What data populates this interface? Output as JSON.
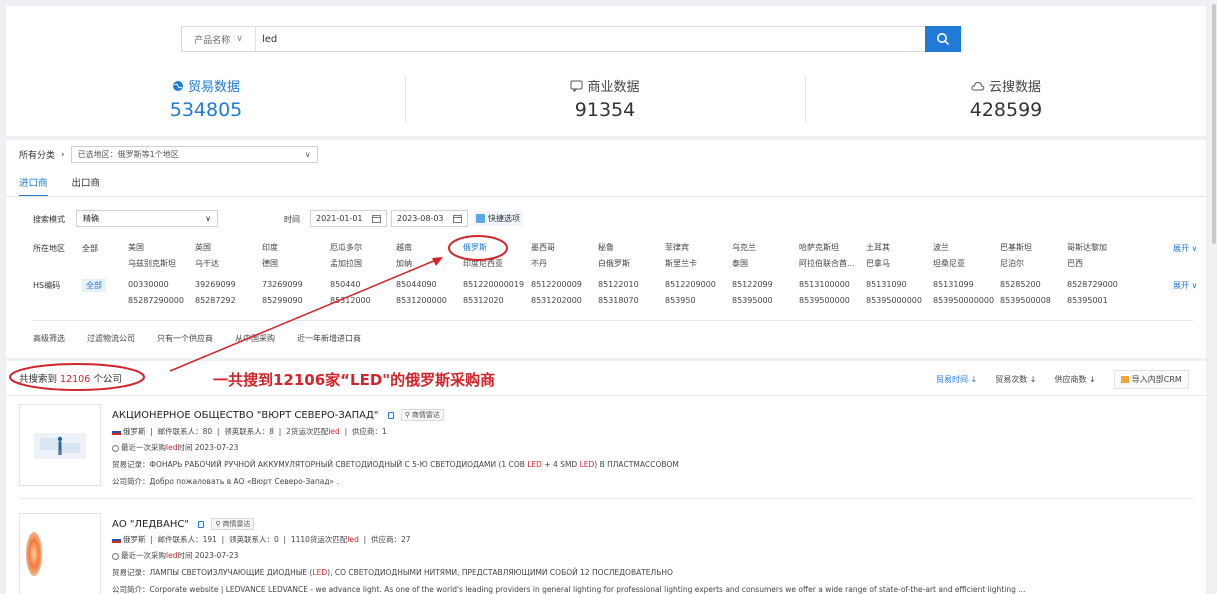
{
  "search": {
    "field_label": "产品名称",
    "value": "led"
  },
  "stats": [
    {
      "label": "贸易数据",
      "value": "534805",
      "icon": "globe-icon",
      "active": true
    },
    {
      "label": "商业数据",
      "value": "91354",
      "icon": "chat-icon",
      "active": false
    },
    {
      "label": "云搜数据",
      "value": "428599",
      "icon": "cloud-icon",
      "active": false
    }
  ],
  "filters": {
    "category_label": "所有分类",
    "region_selected": "已选地区：俄罗斯等1个地区",
    "tabs": [
      "进口商",
      "出口商"
    ],
    "mode_label": "搜索模式",
    "mode_value": "精确",
    "time_label": "时间",
    "date_from": "2021-01-01",
    "date_to": "2023-08-03",
    "quick_options": "快捷选项",
    "region_label": "所在地区",
    "hs_label": "HS编码",
    "all_label": "全部",
    "expand_label": "展开",
    "regions": [
      [
        "美国",
        "乌兹别克斯坦"
      ],
      [
        "英国",
        "乌干达"
      ],
      [
        "印度",
        "德国"
      ],
      [
        "厄瓜多尔",
        "孟加拉国"
      ],
      [
        "越南",
        "加纳"
      ],
      [
        "俄罗斯",
        "印度尼西亚"
      ],
      [
        "墨西哥",
        "不丹"
      ],
      [
        "秘鲁",
        "白俄罗斯"
      ],
      [
        "菲律宾",
        "斯里兰卡"
      ],
      [
        "乌克兰",
        "泰国"
      ],
      [
        "哈萨克斯坦",
        "阿拉伯联合酋..."
      ],
      [
        "土耳其",
        "巴拿马"
      ],
      [
        "波兰",
        "坦桑尼亚"
      ],
      [
        "巴基斯坦",
        "尼泊尔"
      ],
      [
        "哥斯达黎加",
        "巴西"
      ]
    ],
    "hs_codes": [
      [
        "00330000",
        "85287290000"
      ],
      [
        "39269099",
        "85287292"
      ],
      [
        "73269099",
        "85299090"
      ],
      [
        "850440",
        "85312000"
      ],
      [
        "85044090",
        "8531200000"
      ],
      [
        "851220000019",
        "85312020"
      ],
      [
        "8512200009",
        "8531202000"
      ],
      [
        "85122010",
        "85318070"
      ],
      [
        "8512209000",
        "853950"
      ],
      [
        "85122099",
        "85395000"
      ],
      [
        "8513100000",
        "8539500000"
      ],
      [
        "85131090",
        "85395000000"
      ],
      [
        "85131099",
        "853950000000"
      ],
      [
        "85285200",
        "8539500008"
      ],
      [
        "8528729000",
        "85395001"
      ]
    ],
    "advanced_label": "高级筛选",
    "advanced_options": [
      "过滤物流公司",
      "只有一个供应商",
      "从中国采购",
      "近一年新增进口商"
    ]
  },
  "results": {
    "prefix": "共搜索到",
    "count": "12106",
    "suffix": "个公司",
    "sort": [
      "贸易时间",
      "贸易次数",
      "供应商数"
    ],
    "export_label": "导入内部CRM",
    "companies": [
      {
        "name": "АКЦИОНЕРНОЕ ОБЩЕСТВО \"ВЮРТ СЕВЕРО-ЗАПАД\"",
        "tag": "商情雷达",
        "country": "俄罗斯",
        "contacts_label": "邮件联系人：",
        "contacts": "80",
        "linkedin_label": "领英联系人：",
        "linkedin": "8",
        "shipments": "2",
        "shipments_label": "货运次匹配",
        "keyword": "led",
        "suppliers_label": "供应商：",
        "suppliers": "1",
        "last_purchase_prefix": "最近一次采购",
        "last_purchase_suffix": "时间 2023-07-23",
        "trade_label": "贸易记录：",
        "trade_a": "ФОНАРЬ РАБОЧИЙ РУЧНОЙ АККУМУЛЯТОРНЫЙ СВЕТОДИОДНЫЙ С 5-Ю СВЕТОДИОДАМИ (1 COB",
        "trade_kw1": "LED",
        "trade_b": "+ 4 SMD",
        "trade_kw2": "LED",
        "trade_c": ") В ПЛАСТМАССОВОМ",
        "intro_label": "公司简介：",
        "intro": "Добро пожаловать в АО «Вюрт Северо-Запад» ."
      },
      {
        "name": "АО \"ЛЕДВАНС\"",
        "tag": "商情雷达",
        "country": "俄罗斯",
        "contacts_label": "邮件联系人：",
        "contacts": "191",
        "linkedin_label": "领英联系人：",
        "linkedin": "0",
        "shipments": "1110",
        "shipments_label": "货运次匹配",
        "keyword": "led",
        "suppliers_label": "供应商：",
        "suppliers": "27",
        "last_purchase_prefix": "最近一次采购",
        "last_purchase_suffix": "时间 2023-07-23",
        "trade_label": "贸易记录：",
        "trade_a": "ЛАМПЫ СВЕТОИЗЛУЧАЮЩИЕ ДИОДНЫЕ (",
        "trade_kw1": "LED",
        "trade_b": "), СО СВЕТОДИОДНЫМИ НИТЯМИ, ПРЕДСТАВЛЯЮЩИМИ СОБОЙ 12 ПОСЛЕДОВАТЕЛЬНО",
        "intro_label": "公司简介：",
        "intro": "Corporate website | LEDVANCE LEDVANCE - we advance light. As one of the world's leading providers in general lighting for professional lighting experts and consumers we offer a wide range of state-of-the-art and efficient lighting ..."
      }
    ]
  },
  "annotation": "一共搜到12106家“LED\"的俄罗斯采购商",
  "colors": {
    "accent": "#1f7ad8",
    "highlight": "#d2242b"
  }
}
